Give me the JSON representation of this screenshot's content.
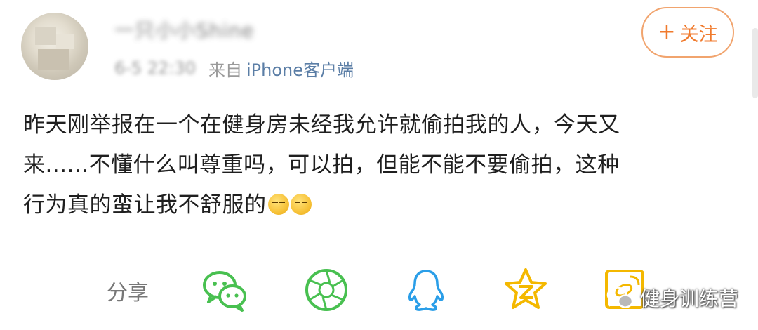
{
  "post": {
    "username": "一只小小Shine",
    "time": "6-5 22:30",
    "from_label": "来自",
    "source": "iPhone客户端",
    "follow_label": "关注",
    "follow_plus": "+",
    "text_lines": [
      "昨天刚举报在一个在健身房未经我允许就偷拍我的人，今天又",
      "来......不懂什么叫尊重吗，可以拍，但能不能不要偷拍，这种",
      "行为真的蛮让我不舒服的"
    ]
  },
  "share": {
    "label": "分享",
    "icons": [
      "wechat-icon",
      "moments-icon",
      "qq-icon",
      "qzone-icon",
      "weibo-share-icon"
    ]
  },
  "watermark": {
    "text": "健身训练营"
  },
  "colors": {
    "accent": "#f07a2c",
    "link": "#5b7ea6",
    "meta": "#9a9a9a",
    "share_icon": "#48c050",
    "qzone": "#f4b800",
    "qq": "#2a9ee8"
  }
}
